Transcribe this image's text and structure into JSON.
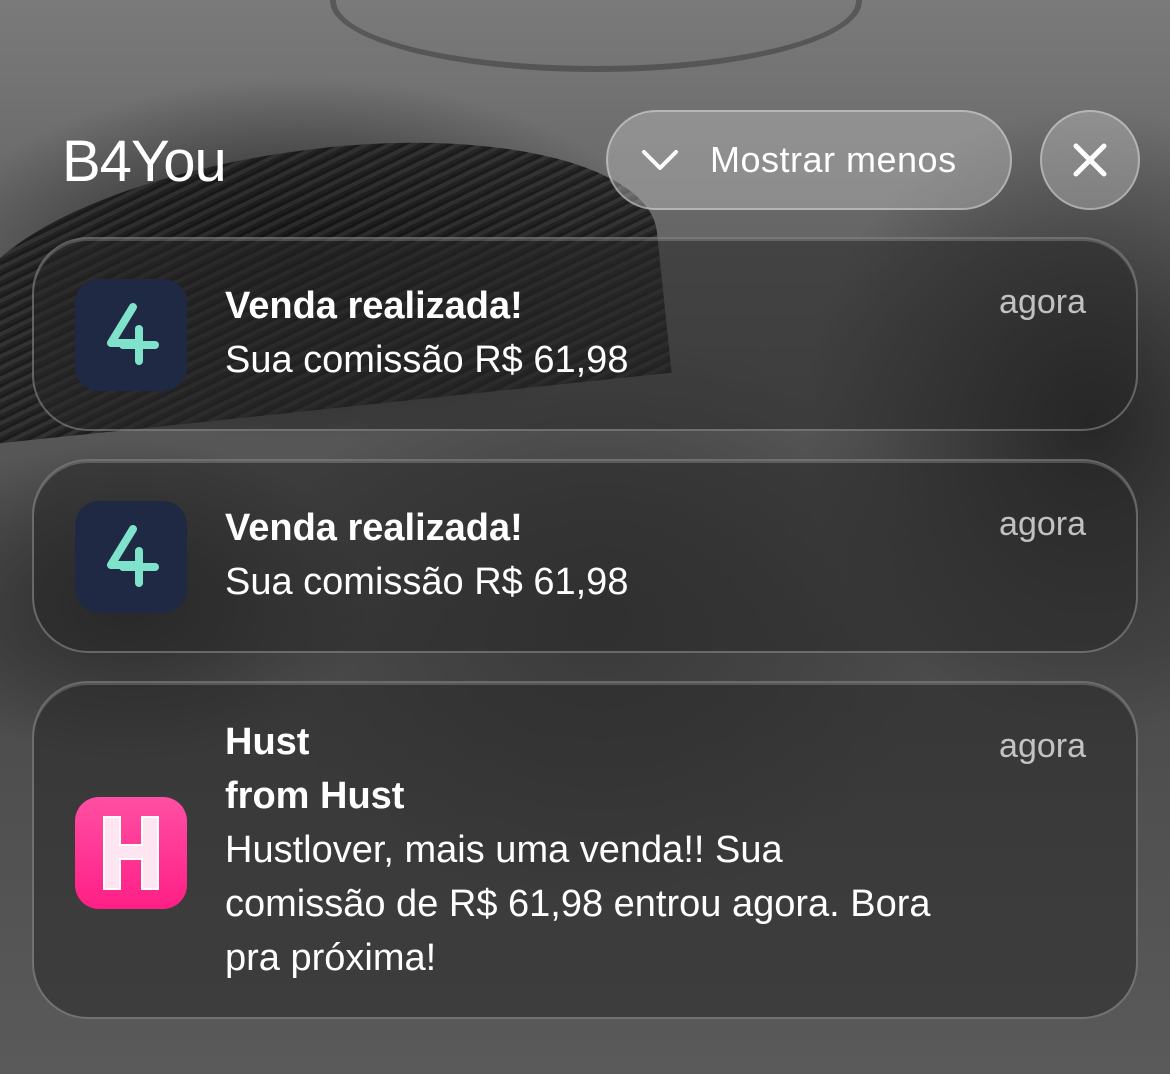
{
  "header": {
    "app_name": "B4You",
    "collapse_label": "Mostrar menos"
  },
  "notifications": [
    {
      "app": "B4You",
      "icon": "b4you-app-icon",
      "title": "Venda realizada!",
      "body": "Sua comissão R$ 61,98",
      "time": "agora"
    },
    {
      "app": "B4You",
      "icon": "b4you-app-icon",
      "title": "Venda realizada!",
      "body": "Sua comissão R$ 61,98",
      "time": "agora"
    },
    {
      "app": "Hust",
      "icon": "hust-app-icon",
      "title": "Hust",
      "subtitle": "from Hust",
      "body_lines": [
        "Hustlover, mais uma venda!! Sua",
        "comissão de R$ 61,98 entrou agora. Bora",
        "pra próxima!"
      ],
      "time": "agora"
    }
  ],
  "colors": {
    "b4you_icon_bg": "#1f2944",
    "b4you_icon_fg": "#7fe3cc",
    "hust_icon_bg": "#ff2d8e"
  }
}
